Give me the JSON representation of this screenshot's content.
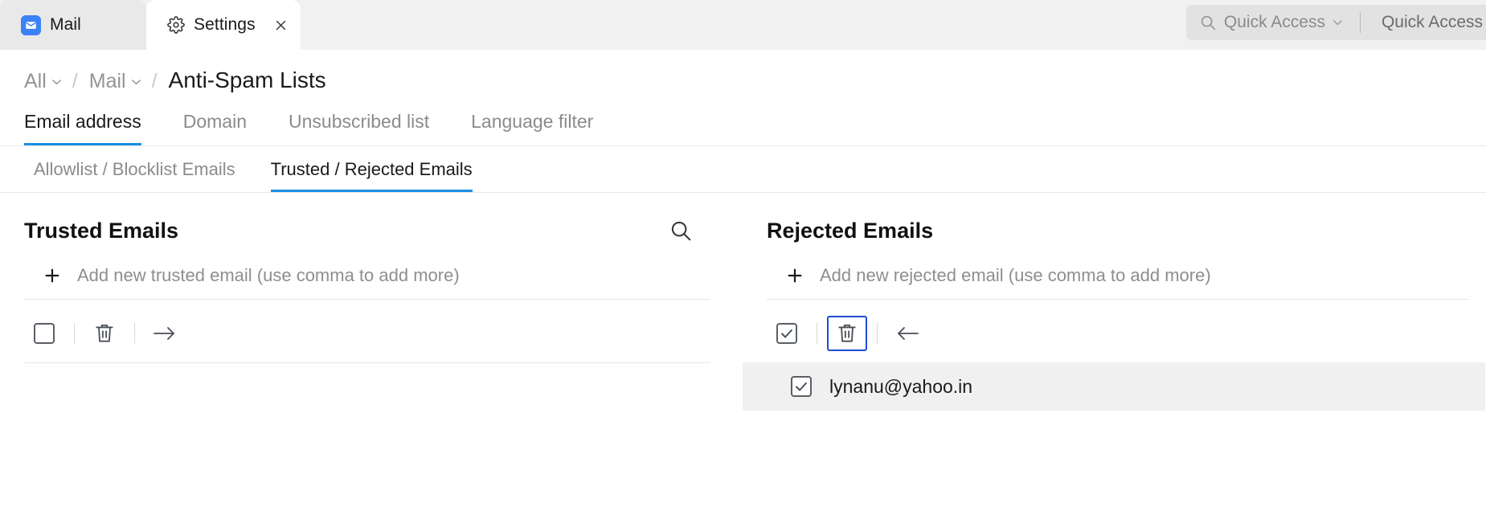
{
  "window": {
    "tabs": [
      {
        "label": "Mail",
        "icon": "mail-icon",
        "active": false
      },
      {
        "label": "Settings",
        "icon": "gear-icon",
        "active": true
      }
    ],
    "quick_access": {
      "search_label": "Quick Access",
      "secondary_label": "Quick Access",
      "search_icon": "search-icon",
      "caret_icon": "chevron-down-icon"
    }
  },
  "breadcrumb": {
    "items": [
      {
        "label": "All",
        "has_caret": true
      },
      {
        "label": "Mail",
        "has_caret": true
      }
    ],
    "separator": "/",
    "current": "Anti-Spam Lists"
  },
  "primary_tabs": [
    {
      "label": "Email address",
      "active": true
    },
    {
      "label": "Domain",
      "active": false
    },
    {
      "label": "Unsubscribed list",
      "active": false
    },
    {
      "label": "Language filter",
      "active": false
    }
  ],
  "sub_tabs": [
    {
      "label": "Allowlist / Blocklist Emails",
      "active": false
    },
    {
      "label": "Trusted / Rejected Emails",
      "active": true
    }
  ],
  "trusted_panel": {
    "title": "Trusted Emails",
    "search_icon": "search-icon",
    "add_label": "Add new trusted email (use comma to add more)",
    "add_icon": "plus-icon",
    "toolbar": {
      "select_all": {
        "icon": "checkbox-unchecked-icon",
        "checked": false
      },
      "delete": {
        "icon": "trash-icon"
      },
      "move": {
        "icon": "arrow-right-icon"
      }
    },
    "rows": []
  },
  "rejected_panel": {
    "title": "Rejected Emails",
    "add_label": "Add new rejected email (use comma to add more)",
    "add_icon": "plus-icon",
    "toolbar": {
      "select_all": {
        "icon": "checkbox-checked-icon",
        "checked": true
      },
      "delete": {
        "icon": "trash-icon",
        "focused": true
      },
      "move": {
        "icon": "arrow-left-icon"
      }
    },
    "rows": [
      {
        "email": "lynanu@yahoo.in",
        "checked": true,
        "selected": true
      }
    ]
  },
  "colors": {
    "accent": "#1a8fe3",
    "focus_ring": "#1d4ed8",
    "mail_tab_icon": "#3b82f6",
    "tabbar_bg": "#f1f1f1",
    "row_selected_bg": "#f0f0f0",
    "muted_text": "#8b8b8b"
  }
}
